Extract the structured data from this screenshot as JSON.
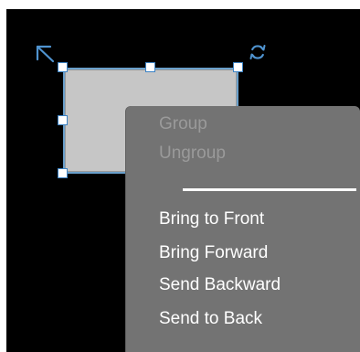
{
  "context_menu": {
    "items": [
      {
        "label": "Group",
        "enabled": false
      },
      {
        "label": "Ungroup",
        "enabled": false
      },
      {
        "label": "Bring to Front",
        "enabled": true
      },
      {
        "label": "Bring Forward",
        "enabled": true
      },
      {
        "label": "Send Backward",
        "enabled": true
      },
      {
        "label": "Send to Back",
        "enabled": true
      }
    ]
  },
  "icons": {
    "resize": "resize-diagonal-icon",
    "rotate": "rotate-icon"
  },
  "colors": {
    "background": "#000000",
    "shape_fill": "#c6c6c6",
    "selection": "#3b82c4",
    "menu_bg": "#737373",
    "menu_text": "#ffffff",
    "menu_disabled": "#9a9a9a"
  }
}
